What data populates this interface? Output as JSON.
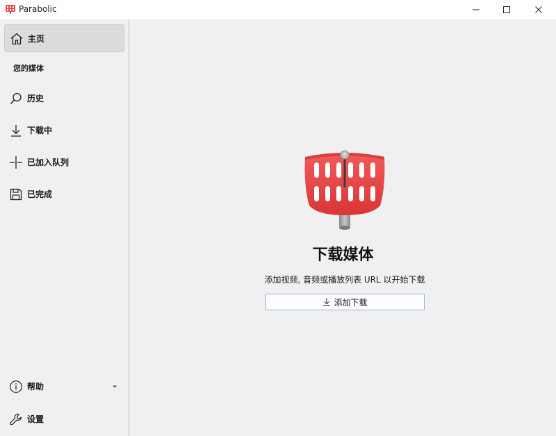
{
  "window": {
    "title": "Parabolic"
  },
  "sidebar": {
    "home_label": "主页",
    "section_label": "您的媒体",
    "history_label": "历史",
    "downloading_label": "下载中",
    "queued_label": "已加入队列",
    "completed_label": "已完成",
    "help_label": "帮助",
    "settings_label": "设置"
  },
  "main": {
    "title": "下载媒体",
    "description": "添加视频, 音频或播放列表 URL 以开始下载",
    "add_button_label": "添加下载"
  },
  "icons": {
    "app": "parabolic-dish-icon",
    "home": "home-icon",
    "history": "search-icon",
    "downloading": "download-arrow-icon",
    "queued": "queue-icon",
    "completed": "save-icon",
    "help": "info-icon",
    "settings": "wrench-icon",
    "add": "download-arrow-icon"
  },
  "colors": {
    "accent_red": "#e84a4a",
    "button_border": "#7fb3e6",
    "active_nav_bg": "#dcdcdc"
  }
}
